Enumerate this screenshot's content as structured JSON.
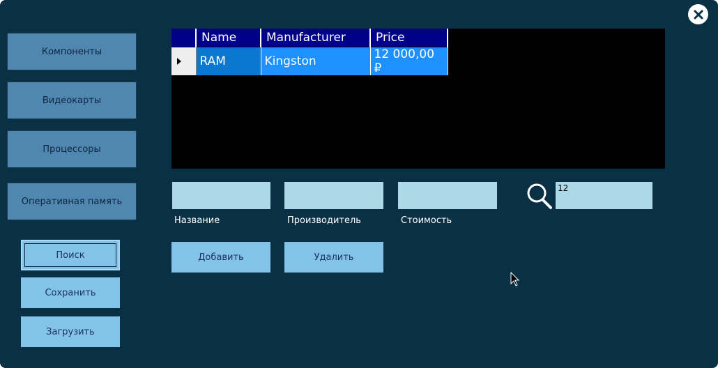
{
  "window": {
    "close_icon": "close-icon"
  },
  "sidebar": {
    "categories": [
      {
        "label": "Компоненты"
      },
      {
        "label": "Видеокарты"
      },
      {
        "label": "Процессоры"
      },
      {
        "label": "Оперативная память"
      }
    ],
    "actions": [
      {
        "label": "Поиск"
      },
      {
        "label": "Сохранить"
      },
      {
        "label": "Загрузить"
      }
    ]
  },
  "grid": {
    "columns": [
      "Name",
      "Manufacturer",
      "Price"
    ],
    "rows": [
      {
        "name": "RAM",
        "manufacturer": "Kingston",
        "price": "12 000,00 ₽"
      }
    ],
    "colors": {
      "header": "#00008b",
      "selection": "#1e90ff",
      "background": "#000000"
    }
  },
  "form": {
    "fields": [
      {
        "label": "Название",
        "value": ""
      },
      {
        "label": "Производитель",
        "value": ""
      },
      {
        "label": "Стоимость",
        "value": ""
      }
    ],
    "add_label": "Добавить",
    "delete_label": "Удалить"
  },
  "search": {
    "icon": "search-icon",
    "value": "12"
  },
  "theme": {
    "background": "#0a3046",
    "category_button": "#4f87b0",
    "action_button": "#83c2e9",
    "input": "#add8e6"
  }
}
